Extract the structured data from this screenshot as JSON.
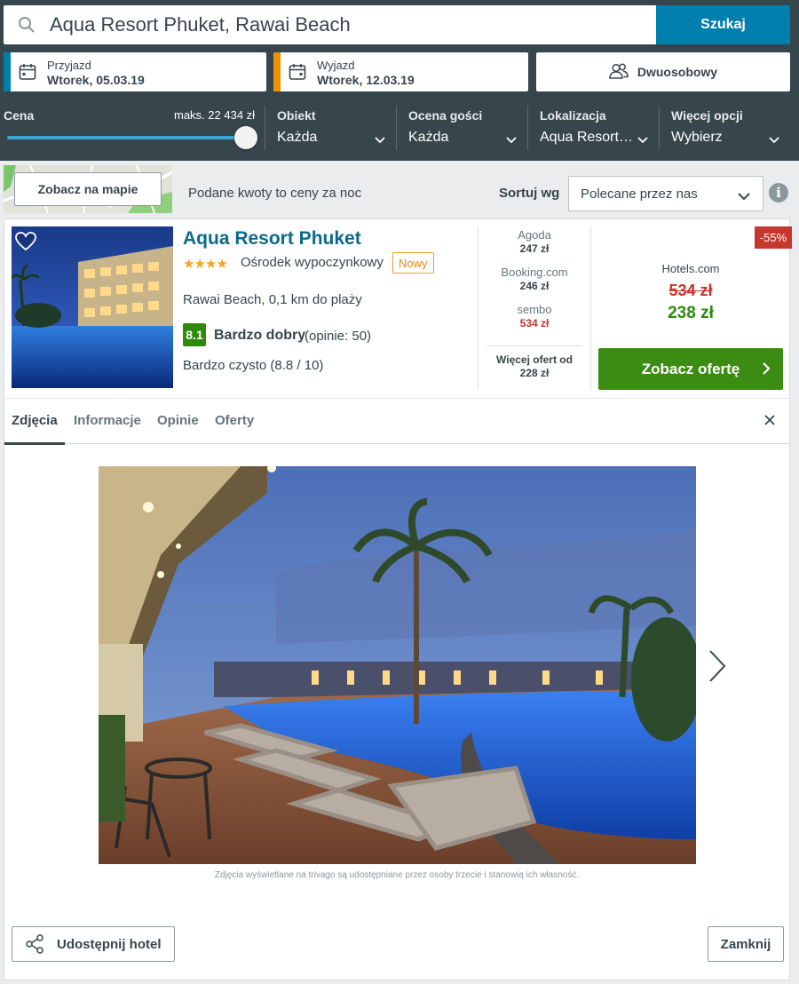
{
  "search": {
    "query": "Aqua Resort Phuket, Rawai Beach",
    "button": "Szukaj"
  },
  "dates": {
    "checkin_label": "Przyjazd",
    "checkin_value": "Wtorek, 05.03.19",
    "checkout_label": "Wyjazd",
    "checkout_value": "Wtorek, 12.03.19"
  },
  "room": {
    "label": "Dwuosobowy"
  },
  "filters": {
    "price": {
      "title": "Cena",
      "max": "maks. 22 434 zł",
      "fill_fraction": 1.0
    },
    "property": {
      "title": "Obiekt",
      "value": "Każda"
    },
    "guest_rating": {
      "title": "Ocena gości",
      "value": "Każda"
    },
    "location": {
      "title": "Lokalizacja",
      "value": "Aqua Resort…"
    },
    "more": {
      "title": "Więcej opcji",
      "value": "Wybierz"
    }
  },
  "toolbar": {
    "map_button": "Zobacz na mapie",
    "notice": "Podane kwoty to ceny za noc",
    "sort_label": "Sortuj wg",
    "sort_value": "Polecane przez nas"
  },
  "hotel": {
    "name": "Aqua Resort Phuket",
    "stars": "★★★★",
    "type": "Ośrodek wypoczynkowy",
    "badge": "Nowy",
    "location": "Rawai Beach, 0,1 km do plaży",
    "rating_score": "8.1",
    "rating_label": "Bardzo dobry",
    "rating_count": "(opinie: 50)",
    "cleanliness": "Bardzo czysto (8.8 / 10)"
  },
  "deals": [
    {
      "provider": "Agoda",
      "price": "247 zł"
    },
    {
      "provider": "Booking.com",
      "price": "246 zł"
    },
    {
      "provider": "sembo",
      "price": "534 zł"
    }
  ],
  "more_deals": {
    "line1": "Więcej ofert od",
    "line2": "228 zł"
  },
  "best_offer": {
    "discount": "-55%",
    "provider": "Hotels.com",
    "old_price": "534 zł",
    "new_price": "238 zł",
    "cta": "Zobacz ofertę"
  },
  "tabs": [
    "Zdjęcia",
    "Informacje",
    "Opinie",
    "Oferty"
  ],
  "photo_credit": "Zdjęcia wyświetlane na trivago są udostępniane przez osoby trzecie i stanowią ich własność.",
  "footer": {
    "share": "Udostępnij hotel",
    "close": "Zamknij"
  },
  "colors": {
    "header": "#37454d",
    "search_button": "#007fad",
    "cta": "#3c8b13",
    "price_green": "#2e8a0a",
    "price_red": "#c6342b",
    "checkin_strip": "#007fad",
    "checkout_strip": "#f29100"
  }
}
